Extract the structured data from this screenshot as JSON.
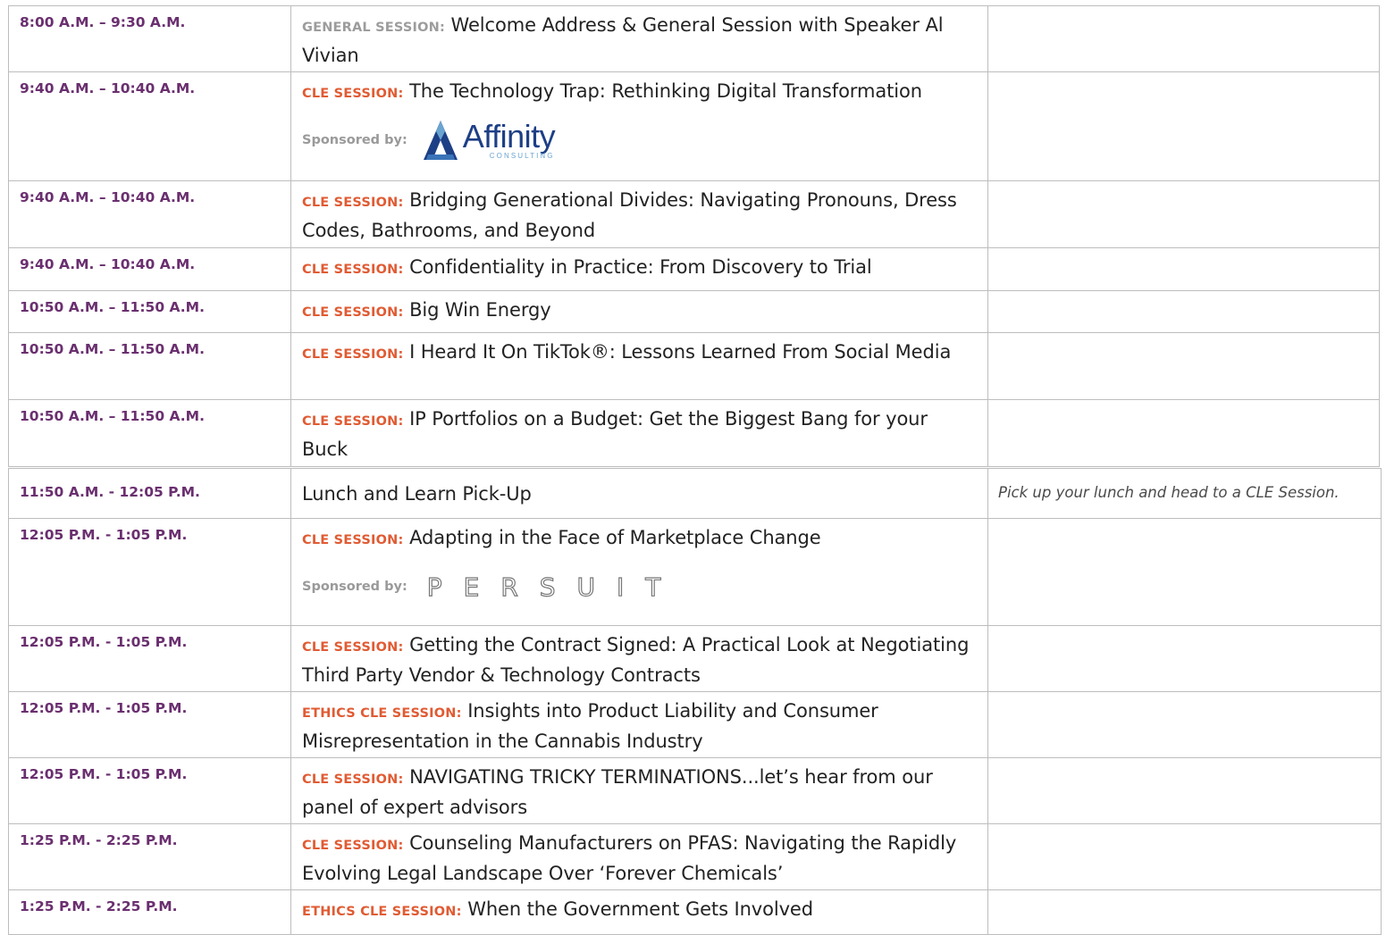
{
  "schedule_top": [
    {
      "time": "8:00 A.M. – 9:30 A.M.",
      "label": "GENERAL SESSION:",
      "label_type": "general",
      "title": "Welcome Address & General Session with Speaker Al Vivian"
    },
    {
      "time": "9:40 A.M. – 10:40 A.M.",
      "label": "CLE SESSION:",
      "label_type": "cle",
      "title": "The Technology Trap: Rethinking Digital Transformation",
      "sponsor_text": "Sponsored by:",
      "sponsor_logo": {
        "name": "Affinity",
        "subtitle": "CONSULTING"
      }
    },
    {
      "time": "9:40 A.M. – 10:40 A.M.",
      "label": "CLE SESSION:",
      "label_type": "cle",
      "title": "Bridging Generational Divides: Navigating Pronouns, Dress Codes, Bathrooms, and Beyond"
    },
    {
      "time": "9:40 A.M. – 10:40 A.M.",
      "label": "CLE SESSION:",
      "label_type": "cle",
      "title": "Confidentiality in Practice: From Discovery to Trial"
    },
    {
      "time": "10:50 A.M. – 11:50 A.M.",
      "label": "CLE SESSION:",
      "label_type": "cle",
      "title": "Big Win Energy"
    },
    {
      "time": "10:50 A.M. – 11:50 A.M.",
      "label": "CLE SESSION:",
      "label_type": "cle",
      "title": "I Heard It On TikTok®: Lessons Learned From Social Media"
    },
    {
      "time": "10:50 A.M. – 11:50 A.M.",
      "label": "CLE SESSION:",
      "label_type": "cle",
      "title": "IP Portfolios on a Budget: Get the Biggest Bang for your Buck"
    }
  ],
  "schedule_bottom": [
    {
      "time": "11:50 A.M. - 12:05 P.M.",
      "title": "Lunch and Learn Pick-Up",
      "note": "Pick up your lunch and head to a CLE Session."
    },
    {
      "time": "12:05 P.M. - 1:05 P.M.",
      "label": "CLE SESSION:",
      "label_type": "cle",
      "title": "Adapting in the Face of Marketplace Change",
      "sponsor_text": "Sponsored by:",
      "sponsor_logo": {
        "name": "PERSUIT"
      }
    },
    {
      "time": "12:05 P.M. - 1:05 P.M.",
      "label": "CLE SESSION:",
      "label_type": "cle",
      "title": "Getting the Contract Signed: A Practical Look at Negotiating Third Party Vendor & Technology Contracts"
    },
    {
      "time": "12:05 P.M. - 1:05 P.M.",
      "label": "ETHICS CLE SESSION:",
      "label_type": "cle",
      "title": "Insights into Product Liability and Consumer Misrepresentation in the Cannabis Industry"
    },
    {
      "time": "12:05 P.M. - 1:05 P.M.",
      "label": "CLE SESSION:",
      "label_type": "cle",
      "title": "NAVIGATING TRICKY TERMINATIONS...let’s hear from our panel of expert advisors"
    },
    {
      "time": "1:25 P.M. - 2:25 P.M.",
      "label": "CLE SESSION:",
      "label_type": "cle",
      "title": "Counseling Manufacturers on PFAS: Navigating the Rapidly Evolving Legal Landscape Over ‘Forever Chemicals’"
    },
    {
      "time": "1:25 P.M. - 2:25 P.M.",
      "label": "ETHICS CLE SESSION:",
      "label_type": "cle",
      "title": "When the Government Gets Involved"
    }
  ],
  "colors": {
    "time": "#6a2f6f",
    "cle_label": "#e05b33",
    "general_label": "#9c9c9c",
    "border": "#bdbdbd",
    "affinity_brand": "#1d3f86"
  }
}
